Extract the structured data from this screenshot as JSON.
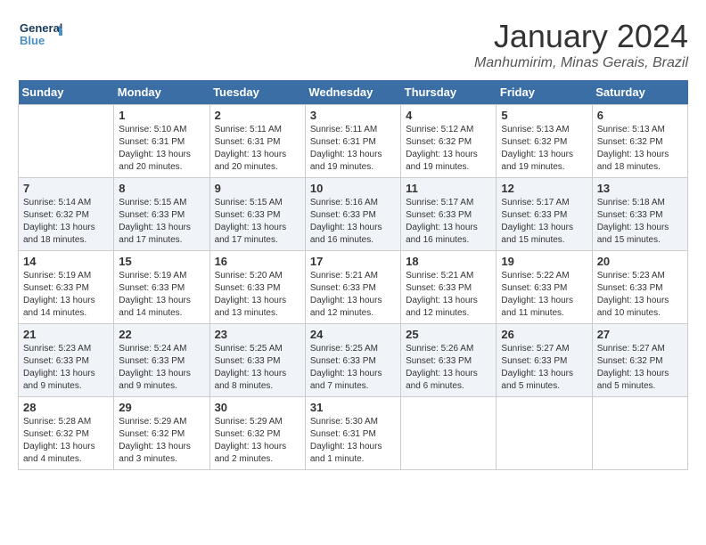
{
  "logo": {
    "line1": "General",
    "line2": "Blue"
  },
  "title": "January 2024",
  "location": "Manhumirim, Minas Gerais, Brazil",
  "weekdays": [
    "Sunday",
    "Monday",
    "Tuesday",
    "Wednesday",
    "Thursday",
    "Friday",
    "Saturday"
  ],
  "days": [
    {
      "num": "",
      "info": ""
    },
    {
      "num": "1",
      "info": "Sunrise: 5:10 AM\nSunset: 6:31 PM\nDaylight: 13 hours\nand 20 minutes."
    },
    {
      "num": "2",
      "info": "Sunrise: 5:11 AM\nSunset: 6:31 PM\nDaylight: 13 hours\nand 20 minutes."
    },
    {
      "num": "3",
      "info": "Sunrise: 5:11 AM\nSunset: 6:31 PM\nDaylight: 13 hours\nand 19 minutes."
    },
    {
      "num": "4",
      "info": "Sunrise: 5:12 AM\nSunset: 6:32 PM\nDaylight: 13 hours\nand 19 minutes."
    },
    {
      "num": "5",
      "info": "Sunrise: 5:13 AM\nSunset: 6:32 PM\nDaylight: 13 hours\nand 19 minutes."
    },
    {
      "num": "6",
      "info": "Sunrise: 5:13 AM\nSunset: 6:32 PM\nDaylight: 13 hours\nand 18 minutes."
    },
    {
      "num": "7",
      "info": "Sunrise: 5:14 AM\nSunset: 6:32 PM\nDaylight: 13 hours\nand 18 minutes."
    },
    {
      "num": "8",
      "info": "Sunrise: 5:15 AM\nSunset: 6:33 PM\nDaylight: 13 hours\nand 17 minutes."
    },
    {
      "num": "9",
      "info": "Sunrise: 5:15 AM\nSunset: 6:33 PM\nDaylight: 13 hours\nand 17 minutes."
    },
    {
      "num": "10",
      "info": "Sunrise: 5:16 AM\nSunset: 6:33 PM\nDaylight: 13 hours\nand 16 minutes."
    },
    {
      "num": "11",
      "info": "Sunrise: 5:17 AM\nSunset: 6:33 PM\nDaylight: 13 hours\nand 16 minutes."
    },
    {
      "num": "12",
      "info": "Sunrise: 5:17 AM\nSunset: 6:33 PM\nDaylight: 13 hours\nand 15 minutes."
    },
    {
      "num": "13",
      "info": "Sunrise: 5:18 AM\nSunset: 6:33 PM\nDaylight: 13 hours\nand 15 minutes."
    },
    {
      "num": "14",
      "info": "Sunrise: 5:19 AM\nSunset: 6:33 PM\nDaylight: 13 hours\nand 14 minutes."
    },
    {
      "num": "15",
      "info": "Sunrise: 5:19 AM\nSunset: 6:33 PM\nDaylight: 13 hours\nand 14 minutes."
    },
    {
      "num": "16",
      "info": "Sunrise: 5:20 AM\nSunset: 6:33 PM\nDaylight: 13 hours\nand 13 minutes."
    },
    {
      "num": "17",
      "info": "Sunrise: 5:21 AM\nSunset: 6:33 PM\nDaylight: 13 hours\nand 12 minutes."
    },
    {
      "num": "18",
      "info": "Sunrise: 5:21 AM\nSunset: 6:33 PM\nDaylight: 13 hours\nand 12 minutes."
    },
    {
      "num": "19",
      "info": "Sunrise: 5:22 AM\nSunset: 6:33 PM\nDaylight: 13 hours\nand 11 minutes."
    },
    {
      "num": "20",
      "info": "Sunrise: 5:23 AM\nSunset: 6:33 PM\nDaylight: 13 hours\nand 10 minutes."
    },
    {
      "num": "21",
      "info": "Sunrise: 5:23 AM\nSunset: 6:33 PM\nDaylight: 13 hours\nand 9 minutes."
    },
    {
      "num": "22",
      "info": "Sunrise: 5:24 AM\nSunset: 6:33 PM\nDaylight: 13 hours\nand 9 minutes."
    },
    {
      "num": "23",
      "info": "Sunrise: 5:25 AM\nSunset: 6:33 PM\nDaylight: 13 hours\nand 8 minutes."
    },
    {
      "num": "24",
      "info": "Sunrise: 5:25 AM\nSunset: 6:33 PM\nDaylight: 13 hours\nand 7 minutes."
    },
    {
      "num": "25",
      "info": "Sunrise: 5:26 AM\nSunset: 6:33 PM\nDaylight: 13 hours\nand 6 minutes."
    },
    {
      "num": "26",
      "info": "Sunrise: 5:27 AM\nSunset: 6:33 PM\nDaylight: 13 hours\nand 5 minutes."
    },
    {
      "num": "27",
      "info": "Sunrise: 5:27 AM\nSunset: 6:32 PM\nDaylight: 13 hours\nand 5 minutes."
    },
    {
      "num": "28",
      "info": "Sunrise: 5:28 AM\nSunset: 6:32 PM\nDaylight: 13 hours\nand 4 minutes."
    },
    {
      "num": "29",
      "info": "Sunrise: 5:29 AM\nSunset: 6:32 PM\nDaylight: 13 hours\nand 3 minutes."
    },
    {
      "num": "30",
      "info": "Sunrise: 5:29 AM\nSunset: 6:32 PM\nDaylight: 13 hours\nand 2 minutes."
    },
    {
      "num": "31",
      "info": "Sunrise: 5:30 AM\nSunset: 6:31 PM\nDaylight: 13 hours\nand 1 minute."
    },
    {
      "num": "",
      "info": ""
    },
    {
      "num": "",
      "info": ""
    },
    {
      "num": "",
      "info": ""
    }
  ]
}
